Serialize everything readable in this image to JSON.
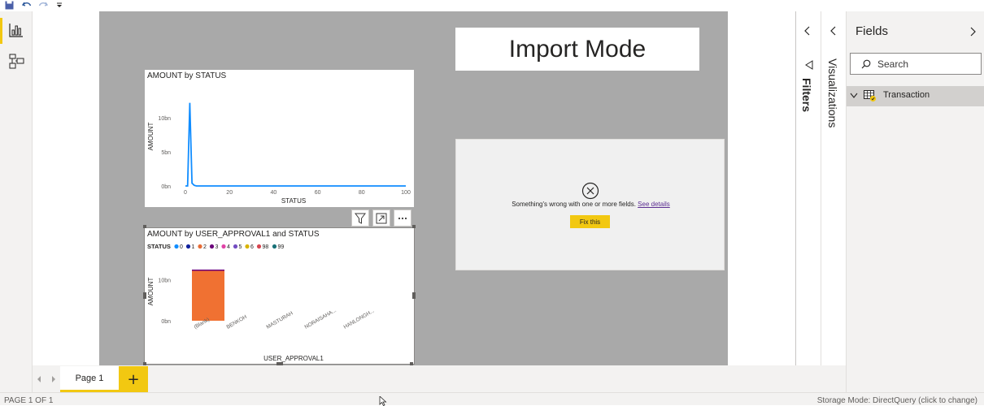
{
  "page": {
    "title_box": "Import Mode",
    "tab_label": "Page 1",
    "add_page": "+"
  },
  "panes": {
    "filters_label": "Filters",
    "visualizations_label": "Visualizations",
    "fields_label": "Fields",
    "search_placeholder": "Search",
    "tables": [
      "Transaction"
    ]
  },
  "error_card": {
    "message": "Something's wrong with one or more fields.",
    "link": "See details",
    "button": "Fix this"
  },
  "status_bar": {
    "page_count": "PAGE 1 OF 1",
    "storage_mode": "Storage Mode: DirectQuery (click to change)"
  },
  "colors": {
    "accent": "#f2c811",
    "canvas_bg": "#a9a9a9",
    "line": "#118dff",
    "bar": "#f07132"
  },
  "chart_data": [
    {
      "type": "line",
      "title": "AMOUNT by STATUS",
      "xlabel": "STATUS",
      "ylabel": "AMOUNT",
      "x_ticks": [
        "0",
        "20",
        "40",
        "60",
        "80",
        "100"
      ],
      "y_ticks": [
        "0bn",
        "5bn",
        "10bn"
      ],
      "xlim": [
        0,
        100
      ],
      "ylim": [
        0,
        13
      ],
      "series": [
        {
          "x": [
            0,
            1,
            2,
            3,
            4,
            5,
            100
          ],
          "y": [
            0,
            0,
            12.2,
            0.4,
            0.1,
            0,
            0
          ]
        }
      ]
    },
    {
      "type": "bar",
      "title": "AMOUNT by USER_APPROVAL1 and STATUS",
      "xlabel": "USER_APPROVAL1",
      "ylabel": "AMOUNT",
      "legend_title": "STATUS",
      "legend": [
        {
          "label": "0",
          "color": "#118dff"
        },
        {
          "label": "1",
          "color": "#12239e"
        },
        {
          "label": "2",
          "color": "#e66c37"
        },
        {
          "label": "3",
          "color": "#6b007b"
        },
        {
          "label": "4",
          "color": "#e044a7"
        },
        {
          "label": "5",
          "color": "#744ec2"
        },
        {
          "label": "6",
          "color": "#d9b300"
        },
        {
          "label": "98",
          "color": "#d64550"
        },
        {
          "label": "99",
          "color": "#197278"
        }
      ],
      "categories": [
        "(Blank)",
        "BENKOH",
        "MASTURAH",
        "NORAISAHA...",
        "HANLONGH..."
      ],
      "values": [
        12.5,
        0,
        0,
        0,
        0
      ],
      "y_ticks": [
        "0bn",
        "10bn"
      ],
      "ylim": [
        0,
        12.5
      ]
    }
  ]
}
